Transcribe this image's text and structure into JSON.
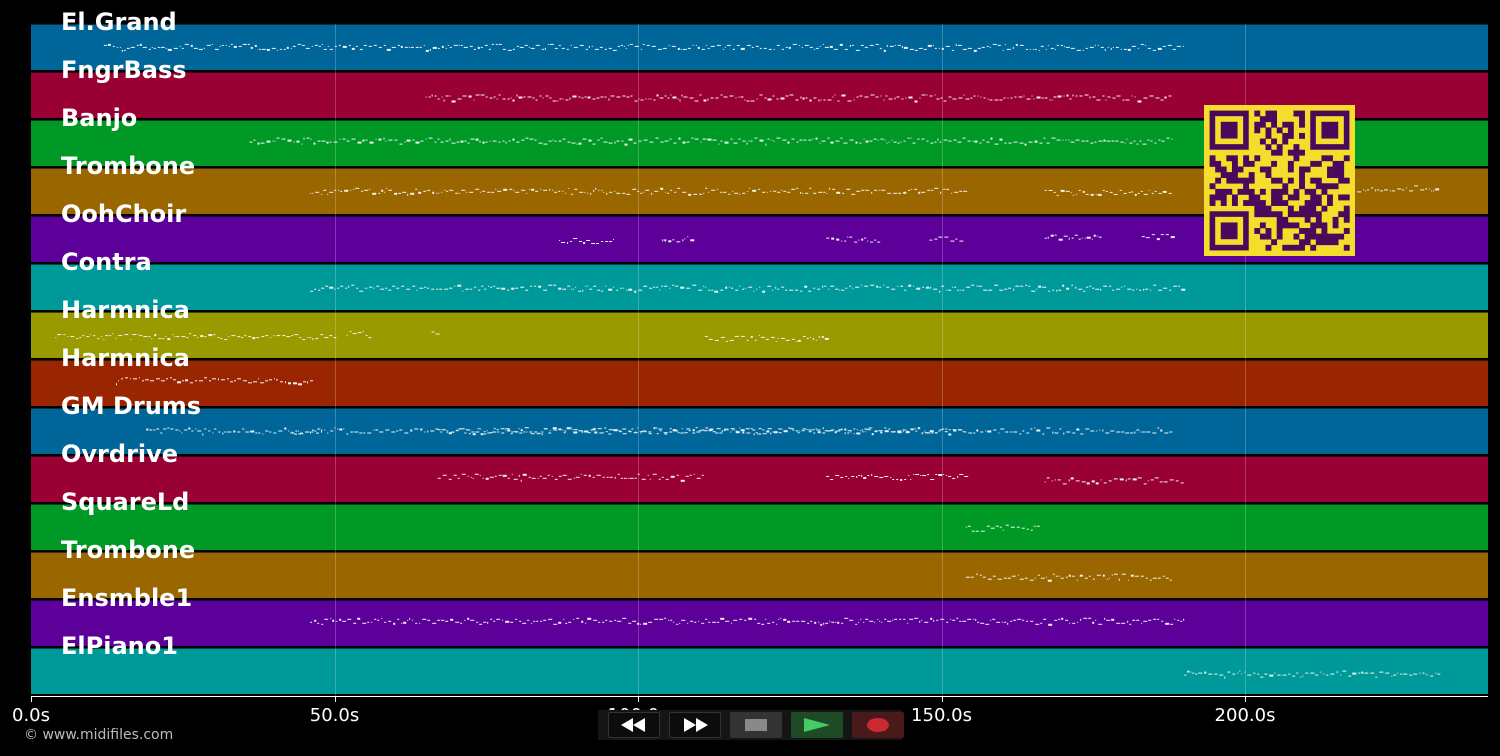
{
  "tracks": [
    {
      "label": "El.Grand",
      "color": "#006699"
    },
    {
      "label": "FngrBass",
      "color": "#990033"
    },
    {
      "label": "Banjo",
      "color": "#009926"
    },
    {
      "label": "Trombone",
      "color": "#996600"
    },
    {
      "label": "OohChoir",
      "color": "#5c0099"
    },
    {
      "label": "Contra",
      "color": "#009999"
    },
    {
      "label": "Harmnica",
      "color": "#999900"
    },
    {
      "label": "Harmnica",
      "color": "#992600"
    },
    {
      "label": "GM Drums",
      "color": "#006699"
    },
    {
      "label": "Ovrdrive",
      "color": "#990033"
    },
    {
      "label": "SquareLd",
      "color": "#009926"
    },
    {
      "label": "Trombone",
      "color": "#996600"
    },
    {
      "label": "Ensmble1",
      "color": "#5c0099"
    },
    {
      "label": "ElPiano1",
      "color": "#009999"
    }
  ],
  "timeline": {
    "ticks": [
      "0.0s",
      "50.0s",
      "100.0s",
      "150.0s",
      "200.0s"
    ],
    "tick_values": [
      0,
      50,
      100,
      150,
      200
    ],
    "max_seconds": 240
  },
  "note_spans": [
    [
      [
        12,
        190
      ]
    ],
    [
      [
        65,
        188
      ]
    ],
    [
      [
        36,
        188
      ]
    ],
    [
      [
        46,
        154
      ],
      [
        167,
        188
      ],
      [
        201,
        232
      ]
    ],
    [
      [
        87,
        96
      ],
      [
        104,
        109
      ],
      [
        131,
        140
      ],
      [
        148,
        153
      ],
      [
        167,
        176
      ],
      [
        183,
        188
      ]
    ],
    [
      [
        46,
        190
      ]
    ],
    [
      [
        4,
        50
      ],
      [
        52,
        56
      ],
      [
        66,
        67
      ],
      [
        111,
        131
      ]
    ],
    [
      [
        14,
        46
      ]
    ],
    [
      [
        19,
        188
      ],
      [
        43,
        48
      ],
      [
        67,
        154
      ]
    ],
    [
      [
        67,
        111
      ],
      [
        131,
        154
      ],
      [
        167,
        190
      ]
    ],
    [
      [
        154,
        166
      ]
    ],
    [
      [
        154,
        188
      ]
    ],
    [
      [
        46,
        190
      ]
    ],
    [
      [
        190,
        232
      ]
    ]
  ],
  "footer": {
    "copyright": "© www.midifiles.com"
  },
  "transport": {
    "rewind_icon": "rewind-icon",
    "forward_icon": "fast-forward-icon",
    "stop_icon": "stop-icon",
    "play_icon": "play-icon",
    "record_icon": "record-icon"
  },
  "colors": {
    "qr_fg": "#4a0a5c",
    "qr_bg": "#f5dd2c",
    "play": "#2aa84a",
    "record": "#cc2a33"
  }
}
